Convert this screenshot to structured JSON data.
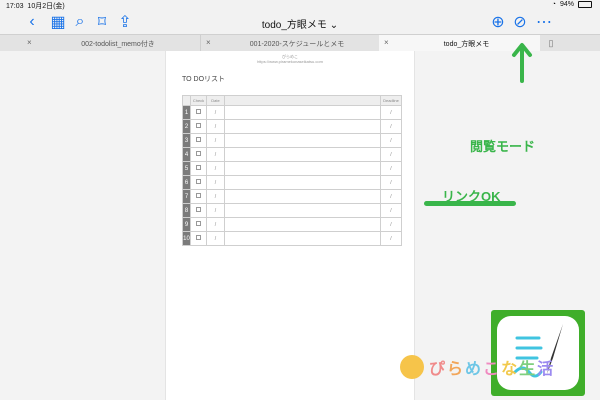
{
  "status": {
    "time": "17:03",
    "date": "10月2日(金)",
    "battery": "94%"
  },
  "toolbar": {
    "title": "todo_方眼メモ",
    "title_chevron": "⌄"
  },
  "tabs": [
    {
      "label": "002-todolist_memo付き",
      "active": false
    },
    {
      "label": "001-2020-スケジュールとメモ",
      "active": false
    },
    {
      "label": "todo_方眼メモ",
      "active": true
    }
  ],
  "doc": {
    "header_top": "ぴらめこ",
    "header_url": "https://www.piramekonaseikatsu.com",
    "title": "TO DOリスト",
    "col_check": "Check",
    "col_date": "Date",
    "col_deadline": "Deadline",
    "date_mark": "/",
    "rows": [
      "1",
      "2",
      "3",
      "4",
      "5",
      "6",
      "7",
      "8",
      "9",
      "10"
    ]
  },
  "annotations": {
    "mode_label": "閲覧モード",
    "link_label": "リンクOK"
  },
  "brand": {
    "name": "ぴらめこな生活"
  },
  "colors": {
    "accent": "#1a73e8",
    "annotation": "#39b54a"
  }
}
